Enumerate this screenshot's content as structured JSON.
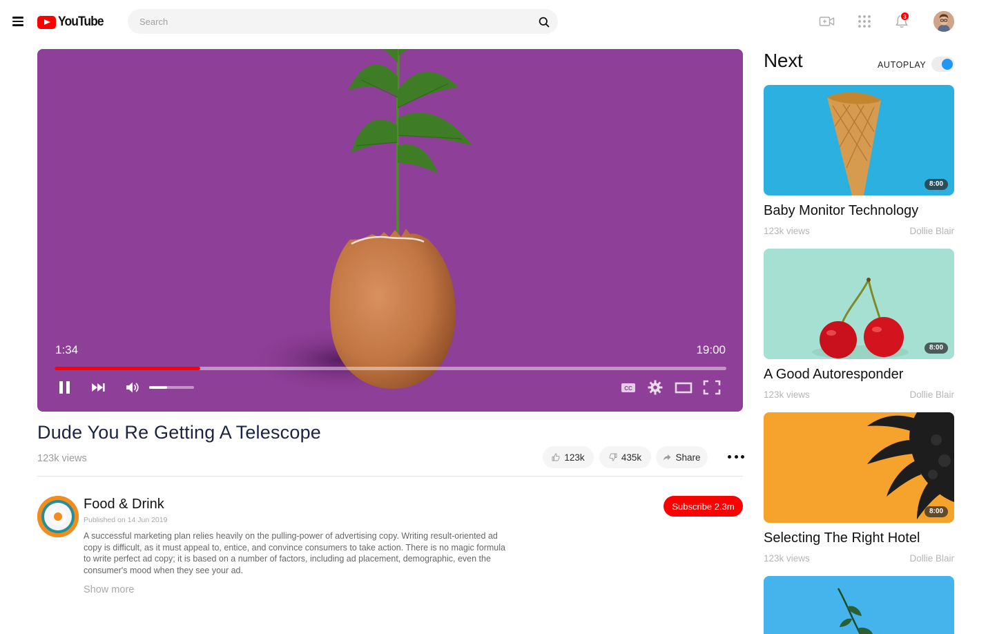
{
  "header": {
    "logo_text": "YouTube",
    "search_placeholder": "Search",
    "notification_count": "3"
  },
  "player": {
    "current_time": "1:34",
    "total_time": "19:00",
    "progress": 0.217,
    "volume": 0.4,
    "background_color": "#8e3f97",
    "accent_color": "#ff0000"
  },
  "video": {
    "title": "Dude You Re Getting A Telescope",
    "views": "123k views",
    "likes": "123k",
    "dislikes": "435k",
    "share_label": "Share"
  },
  "channel": {
    "name": "Food & Drink",
    "published": "Published on 14 Jun 2019",
    "description": "A successful marketing plan relies heavily on the pulling-power of advertising copy. Writing result-oriented ad copy is difficult, as it must appeal to, entice, and convince consumers to take action. There is no magic formula to write perfect ad copy; it is based on a number of factors, including ad placement, demographic, even the consumer's mood when they see your ad.",
    "show_more": "Show more",
    "subscribe_label": "Subscribe 2.3m"
  },
  "sidebar": {
    "heading": "Next",
    "autoplay_label": "AUTOPLAY",
    "autoplay_on": true,
    "cards": [
      {
        "title": "Baby Monitor Technology",
        "views": "123k views",
        "author": "Dollie Blair",
        "duration": "8:00",
        "thumb_color": "#2bb0e0"
      },
      {
        "title": "A Good Autoresponder",
        "views": "123k views",
        "author": "Dollie Blair",
        "duration": "8:00",
        "thumb_color": "#a6e0d3"
      },
      {
        "title": "Selecting The Right Hotel",
        "views": "123k views",
        "author": "Dollie Blair",
        "duration": "8:00",
        "thumb_color": "#f5a32c"
      },
      {
        "thumb_color": "#45b3ec"
      }
    ]
  }
}
